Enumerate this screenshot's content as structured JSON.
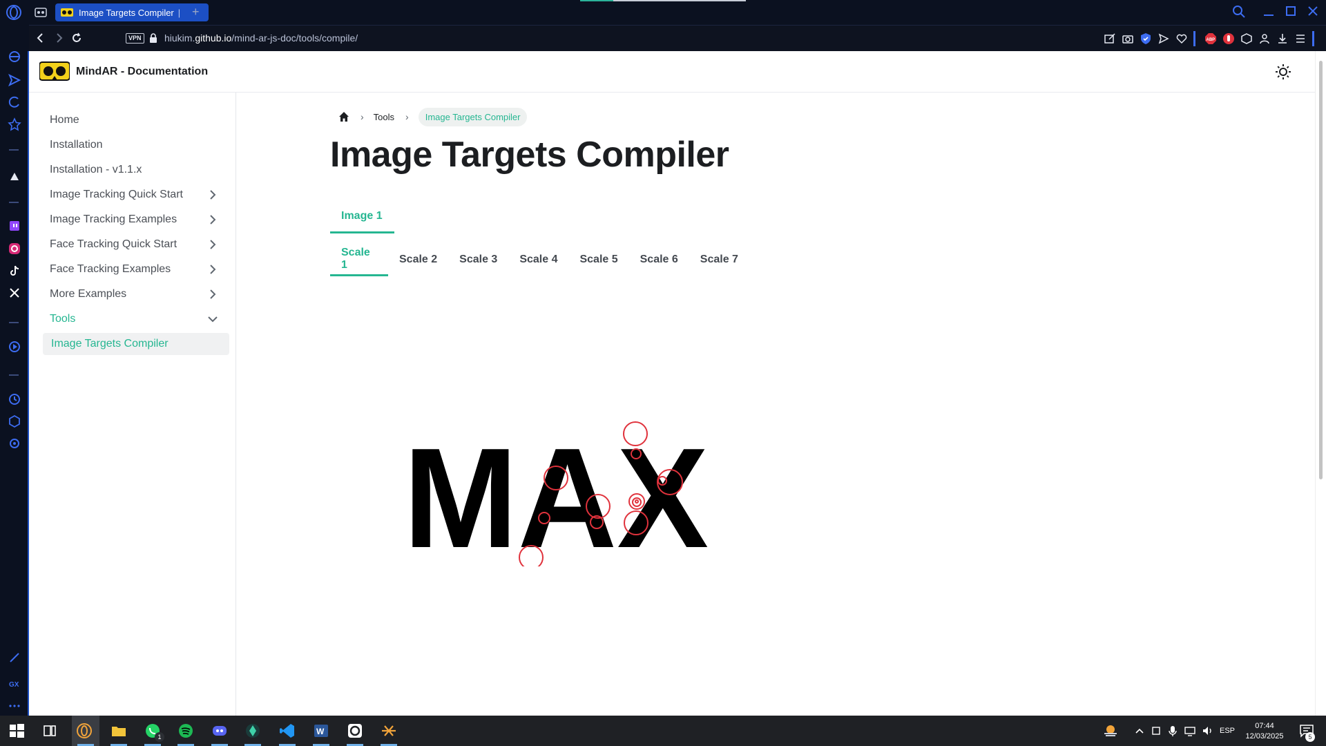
{
  "browser": {
    "tab_title": "Image Targets Compiler",
    "tab_separator": "|",
    "new_tab": "+",
    "vpn_label": "VPN",
    "url_prefix": "hiukim.",
    "url_domain": "github.io",
    "url_path": "/mind-ar-js-doc/tools/compile/"
  },
  "site": {
    "title": "MindAR - Documentation"
  },
  "sidebar": {
    "items": [
      {
        "label": "Home"
      },
      {
        "label": "Installation"
      },
      {
        "label": "Installation - v1.1.x"
      },
      {
        "label": "Image Tracking Quick Start"
      },
      {
        "label": "Image Tracking Examples"
      },
      {
        "label": "Face Tracking Quick Start"
      },
      {
        "label": "Face Tracking Examples"
      },
      {
        "label": "More Examples"
      },
      {
        "label": "Tools"
      },
      {
        "label": "Image Targets Compiler"
      }
    ]
  },
  "breadcrumb": {
    "separator": "›",
    "tools": "Tools",
    "current": "Image Targets Compiler"
  },
  "main": {
    "title": "Image Targets Compiler",
    "image_tabs": [
      "Image 1"
    ],
    "scale_tabs": [
      "Scale 1",
      "Scale 2",
      "Scale 3",
      "Scale 4",
      "Scale 5",
      "Scale 6",
      "Scale 7"
    ],
    "preview_text": "MAX"
  },
  "taskbar": {
    "whatsapp_badge": "1",
    "language": "ESP",
    "time": "07:44",
    "date": "12/03/2025",
    "notifications": "5"
  },
  "colors": {
    "accent": "#25b691",
    "browser_dark": "#0b1120",
    "tab_active": "#1c4fc4",
    "feature_circle": "#e0323c"
  }
}
